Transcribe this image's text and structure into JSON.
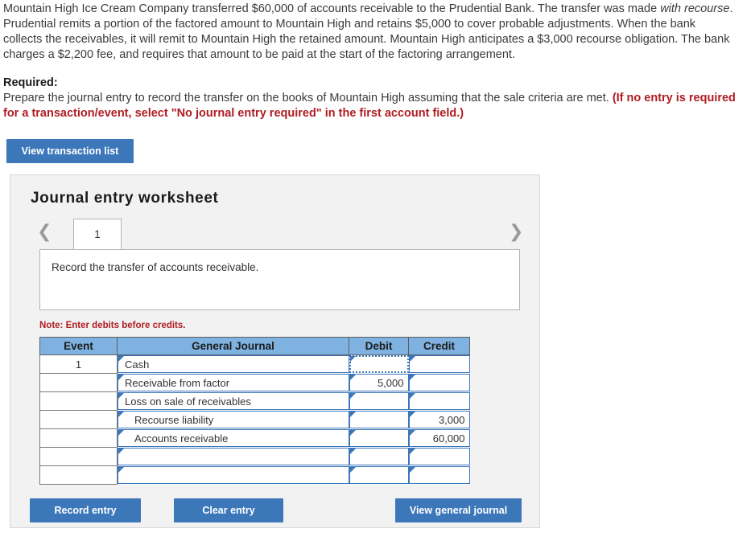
{
  "problem": {
    "part1": "Mountain High Ice Cream Company transferred $60,000 of accounts receivable to the Prudential Bank. The transfer was made ",
    "emphasis": "with recourse",
    "part2": ". Prudential remits a portion of the factored amount to Mountain High and retains $5,000 to cover probable adjustments. When the bank collects the receivables, it will remit to Mountain High the retained amount. Mountain High anticipates a $3,000 recourse obligation. The bank charges a $2,200 fee, and requires that amount to be paid at the start of the factoring arrangement."
  },
  "required": {
    "label": "Required:",
    "text": "Prepare the journal entry to record the transfer on the books of Mountain High assuming that the sale criteria are met. ",
    "red_note": "(If no entry is required for a transaction/event, select \"No journal entry required\" in the first account field.)"
  },
  "toolbar": {
    "view_transaction_list": "View transaction list"
  },
  "worksheet": {
    "title": "Journal entry worksheet",
    "prev_icon": "chevron-left",
    "next_icon": "chevron-right",
    "tabs": [
      {
        "label": "1",
        "active": true
      }
    ],
    "instruction": "Record the transfer of accounts receivable.",
    "note": "Note: Enter debits before credits."
  },
  "table": {
    "headers": {
      "event": "Event",
      "general_journal": "General Journal",
      "debit": "Debit",
      "credit": "Credit"
    },
    "rows": [
      {
        "event": "1",
        "account": "Cash",
        "indent": false,
        "debit": "",
        "credit": "",
        "debit_focused": true
      },
      {
        "event": "",
        "account": "Receivable from factor",
        "indent": false,
        "debit": "5,000",
        "credit": "",
        "debit_focused": false
      },
      {
        "event": "",
        "account": "Loss on sale of receivables",
        "indent": false,
        "debit": "",
        "credit": "",
        "debit_focused": false
      },
      {
        "event": "",
        "account": "Recourse liability",
        "indent": true,
        "debit": "",
        "credit": "3,000",
        "debit_focused": false
      },
      {
        "event": "",
        "account": "Accounts receivable",
        "indent": true,
        "debit": "",
        "credit": "60,000",
        "debit_focused": false
      },
      {
        "event": "",
        "account": "",
        "indent": false,
        "debit": "",
        "credit": "",
        "debit_focused": false
      },
      {
        "event": "",
        "account": "",
        "indent": false,
        "debit": "",
        "credit": "",
        "debit_focused": false
      }
    ]
  },
  "footer": {
    "record_entry": "Record entry",
    "clear_entry": "Clear entry",
    "view_general_journal": "View general journal"
  },
  "colors": {
    "button_blue": "#3c77ba",
    "header_blue": "#7fb2e0",
    "red": "#b01c22",
    "panel_gray": "#f2f2f2"
  }
}
